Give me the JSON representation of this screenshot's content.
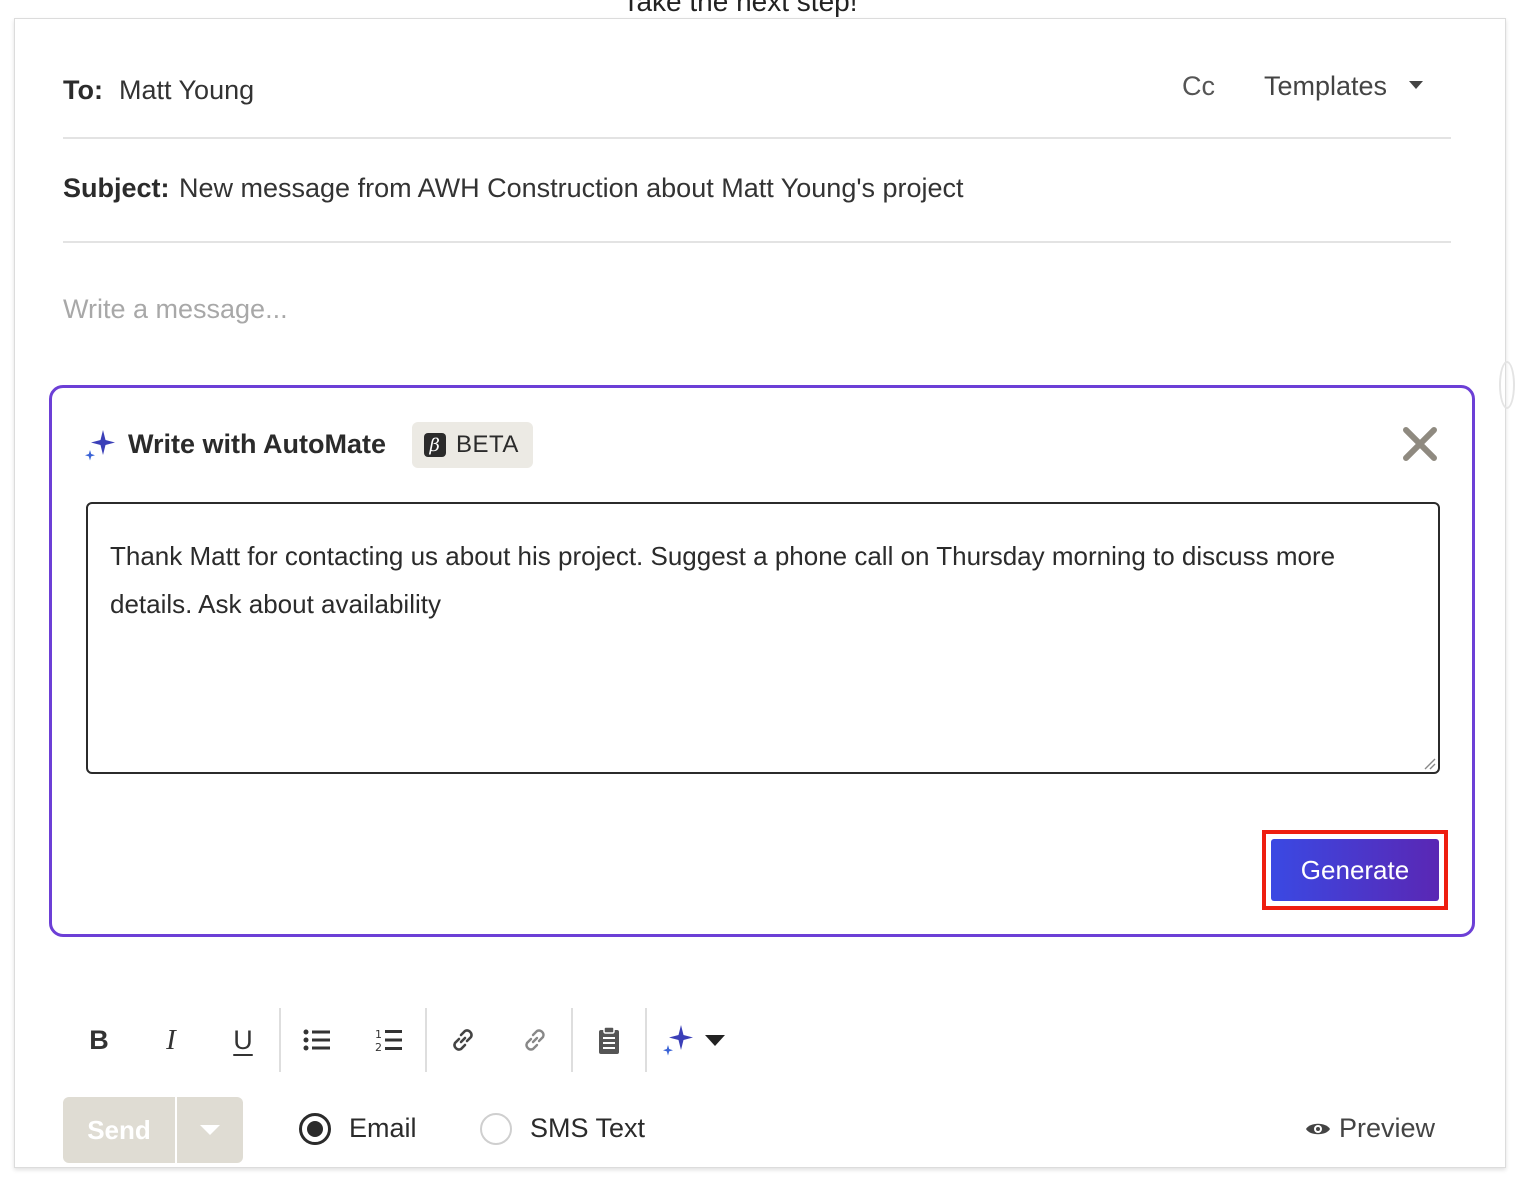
{
  "page": {
    "heading": "Take the next step!"
  },
  "compose": {
    "to_label": "To:",
    "to_value": "Matt Young",
    "cc_label": "Cc",
    "templates_label": "Templates",
    "subject_label": "Subject:",
    "subject_value": "New message from AWH Construction about Matt Young's project",
    "message_placeholder": "Write a message..."
  },
  "ai_panel": {
    "title": "Write with AutoMate",
    "badge_glyph": "β",
    "badge_label": "BETA",
    "prompt_text": "Thank Matt for contacting us about his project. Suggest a phone call on Thursday morning to discuss more details. Ask about availability",
    "generate_label": "Generate",
    "accent_color": "#6c3fd6"
  },
  "toolbar": {
    "bold_label": "B",
    "italic_label": "I",
    "underline_label": "U",
    "icons": [
      "bold-icon",
      "italic-icon",
      "underline-icon",
      "bullet-list-icon",
      "numbered-list-icon",
      "link-icon",
      "unlink-icon",
      "clipboard-icon",
      "sparkle-icon",
      "chevron-down-icon"
    ]
  },
  "footer": {
    "send_label": "Send",
    "email_label": "Email",
    "sms_label": "SMS Text",
    "selected_channel": "Email",
    "preview_label": "Preview"
  }
}
